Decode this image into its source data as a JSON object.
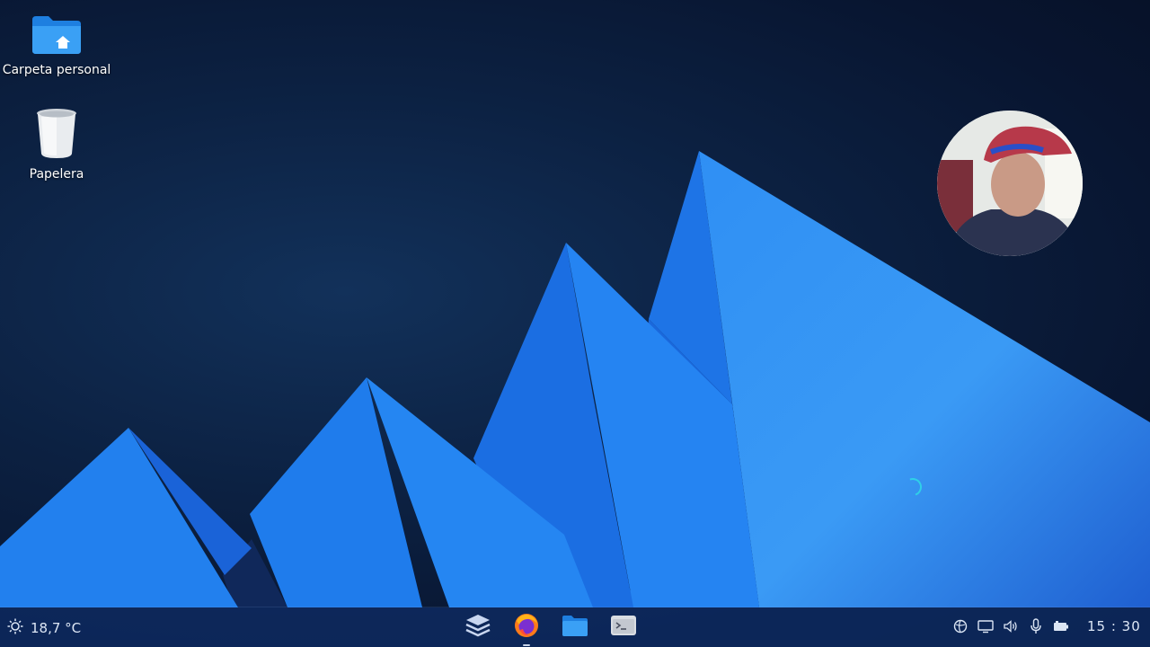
{
  "desktop": {
    "icons": [
      {
        "label": "Carpeta personal",
        "icon": "home-folder-icon"
      },
      {
        "label": "Papelera",
        "icon": "trash-icon"
      }
    ],
    "accent": "#1e8cf0"
  },
  "overlay": {
    "webcam": "presenter-webcam-bubble",
    "loading": "busy-spinner-icon"
  },
  "taskbar": {
    "weather": {
      "icon": "sun-icon",
      "temperature": "18,7 °C"
    },
    "dock": [
      {
        "name": "workspaces-icon"
      },
      {
        "name": "firefox-icon",
        "active": true
      },
      {
        "name": "file-manager-icon"
      },
      {
        "name": "terminal-icon"
      }
    ],
    "tray": [
      "network-globe-icon",
      "display-icon",
      "volume-icon",
      "microphone-icon",
      "battery-icon"
    ],
    "clock": "15 : 30"
  }
}
